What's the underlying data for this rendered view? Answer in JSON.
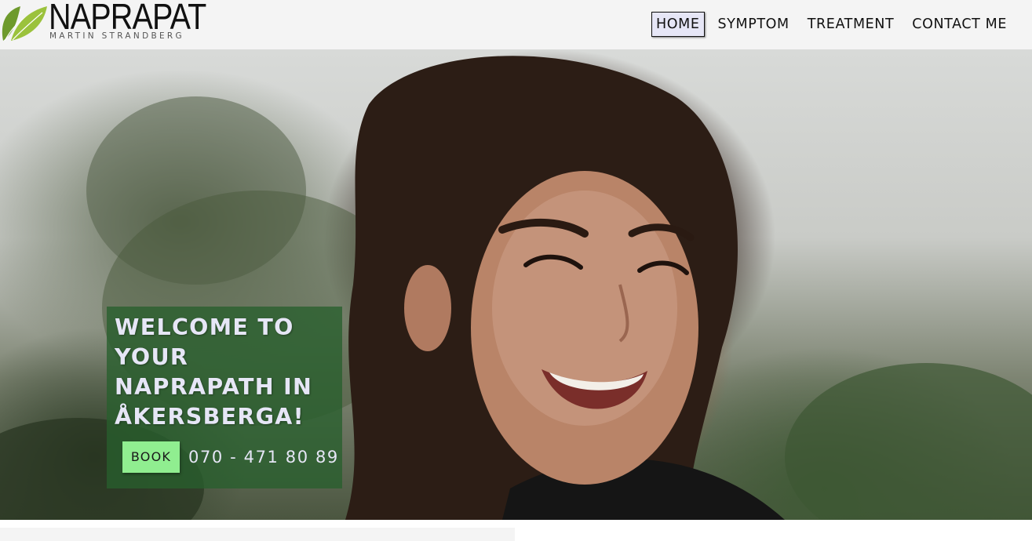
{
  "brand": {
    "title": "NAPRAPAT",
    "subtitle": "MARTIN STRANDBERG",
    "leaf_colors": [
      "#6e9a2c",
      "#9bc23c"
    ]
  },
  "nav": {
    "items": [
      {
        "label": "HOME",
        "active": true
      },
      {
        "label": "SYMPTOM",
        "active": false
      },
      {
        "label": "TREATMENT",
        "active": false
      },
      {
        "label": "CONTACT ME",
        "active": false
      }
    ]
  },
  "hero": {
    "image": "smiling-woman-photo",
    "welcome_lines": [
      "WELCOME TO",
      "YOUR",
      "NAPRAPATH IN",
      "ÅKERSBERGA!"
    ],
    "book_label": "BOOK",
    "phone": "070 - 471 80 89"
  },
  "colors": {
    "header_bg": "#f4f4f4",
    "active_nav_bg": "#e6e6f6",
    "overlay_green": "#285f2d",
    "book_button": "#90ee90",
    "welcome_text": "#e6e6f6"
  }
}
